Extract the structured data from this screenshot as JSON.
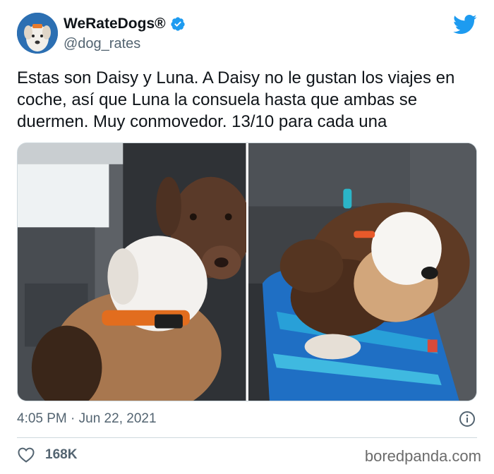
{
  "user": {
    "display_name": "WeRateDogs®",
    "handle": "@dog_rates"
  },
  "tweet": {
    "text": "Estas son Daisy y Luna. A Daisy no le gustan los viajes en coche, así que Luna la consuela hasta que ambas se duermen. Muy conmovedor. 13/10 para cada una",
    "timestamp": "4:05 PM · Jun 22, 2021",
    "like_count": "168K"
  },
  "media": {
    "photo_left_icon": "dog-photo",
    "photo_right_icon": "dog-photo"
  },
  "icons": {
    "verified": "verified-badge-icon",
    "platform": "twitter-bird-icon",
    "info": "info-icon",
    "like": "heart-icon"
  },
  "watermark": "boredpanda.com",
  "colors": {
    "verified": "#1d9bf0",
    "twitter_brand": "#1d9bf0",
    "muted_text": "#536471",
    "divider": "#cfd9de"
  }
}
